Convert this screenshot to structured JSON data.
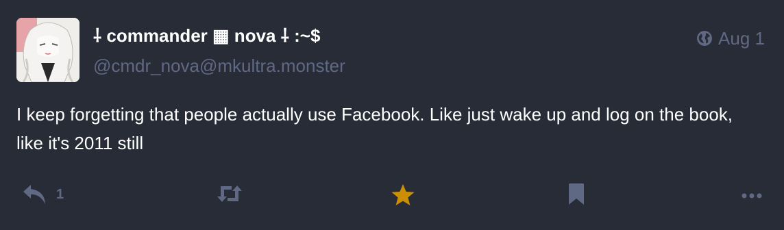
{
  "status": {
    "display_name": "ꟷ commander ▦ nova ꟷ :~$",
    "display_name_text": "⸸ commander ▦ nova ⸸ :~$",
    "account": "@cmdr_nova@mkultra.monster",
    "timestamp": "Aug 1",
    "visibility_icon": "globe-icon",
    "content": "I keep forgetting that people actually use Facebook. Like just wake up and log on the book, like it's 2011 still",
    "actions": {
      "reply_count": "1",
      "reply_icon": "reply-icon",
      "boost_icon": "boost-icon",
      "favourite_icon": "star-icon",
      "bookmark_icon": "bookmark-icon",
      "more_icon": "ellipsis-icon"
    },
    "colors": {
      "background": "#282c37",
      "muted": "#606984",
      "favourite_active": "#ca8f04",
      "text": "#ffffff"
    }
  }
}
